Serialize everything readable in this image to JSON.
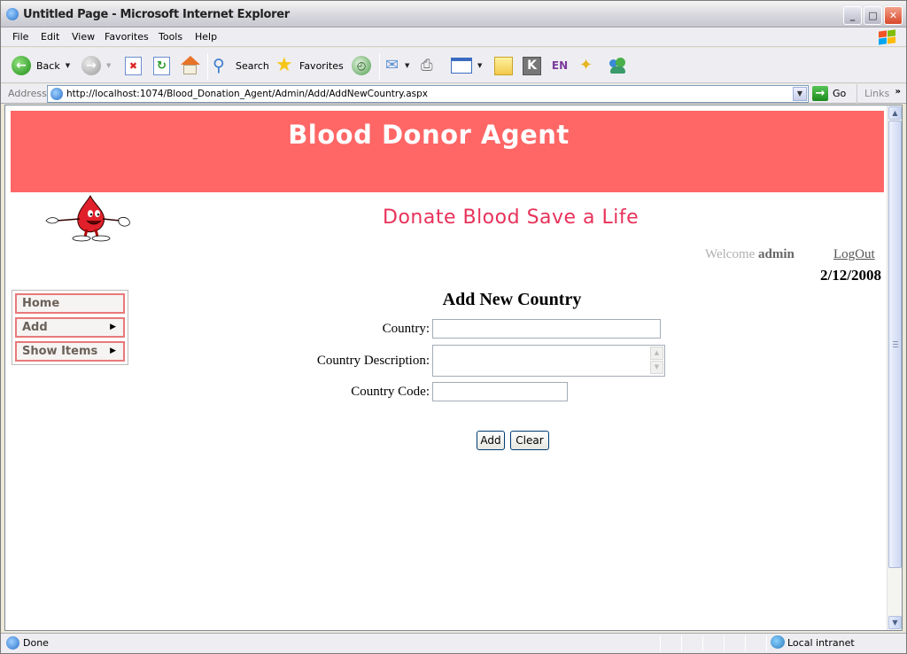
{
  "window": {
    "title": "Untitled Page - Microsoft Internet Explorer",
    "controls": {
      "minimize": "_",
      "maximize": "□",
      "close": "✕"
    }
  },
  "menubar": {
    "items": [
      {
        "label": "File",
        "accel": "F"
      },
      {
        "label": "Edit",
        "accel": "E"
      },
      {
        "label": "View",
        "accel": "V"
      },
      {
        "label": "Favorites",
        "accel": "a"
      },
      {
        "label": "Tools",
        "accel": "T"
      },
      {
        "label": "Help",
        "accel": "H"
      }
    ]
  },
  "toolbar": {
    "back_label": "Back",
    "search_label": "Search",
    "favorites_label": "Favorites",
    "icons": [
      "back-icon",
      "forward-icon",
      "stop-icon",
      "refresh-icon",
      "home-icon",
      "search-icon",
      "favorites-icon",
      "history-icon",
      "mail-icon",
      "print-icon",
      "edit-icon",
      "note-icon",
      "k-icon",
      "translate-icon",
      "mobile-favorites-icon",
      "messenger-icon"
    ]
  },
  "addressbar": {
    "label": "Address",
    "url": "http://localhost:1074/Blood_Donation_Agent/Admin/Add/AddNewCountry.aspx",
    "go_label": "Go",
    "links_label": "Links"
  },
  "page": {
    "banner_title": "Blood Donor Agent",
    "tagline": "Donate Blood Save a Life",
    "welcome_text": "Welcome",
    "username": "admin",
    "logout_label": "LogOut",
    "date": "2/12/2008",
    "colors": {
      "banner": "#ff6666",
      "tagline": "#e8325a",
      "menu_border": "#e8797a"
    },
    "nav_menu": [
      {
        "label": "Home",
        "has_submenu": false
      },
      {
        "label": "Add",
        "has_submenu": true
      },
      {
        "label": "Show Items",
        "has_submenu": true
      }
    ],
    "form": {
      "title": "Add New Country",
      "fields": [
        {
          "label": "Country:",
          "value": ""
        },
        {
          "label": "Country Description:",
          "value": ""
        },
        {
          "label": "Country Code:",
          "value": ""
        }
      ],
      "add_label": "Add",
      "clear_label": "Clear"
    }
  },
  "statusbar": {
    "status": "Done",
    "zone": "Local intranet"
  }
}
